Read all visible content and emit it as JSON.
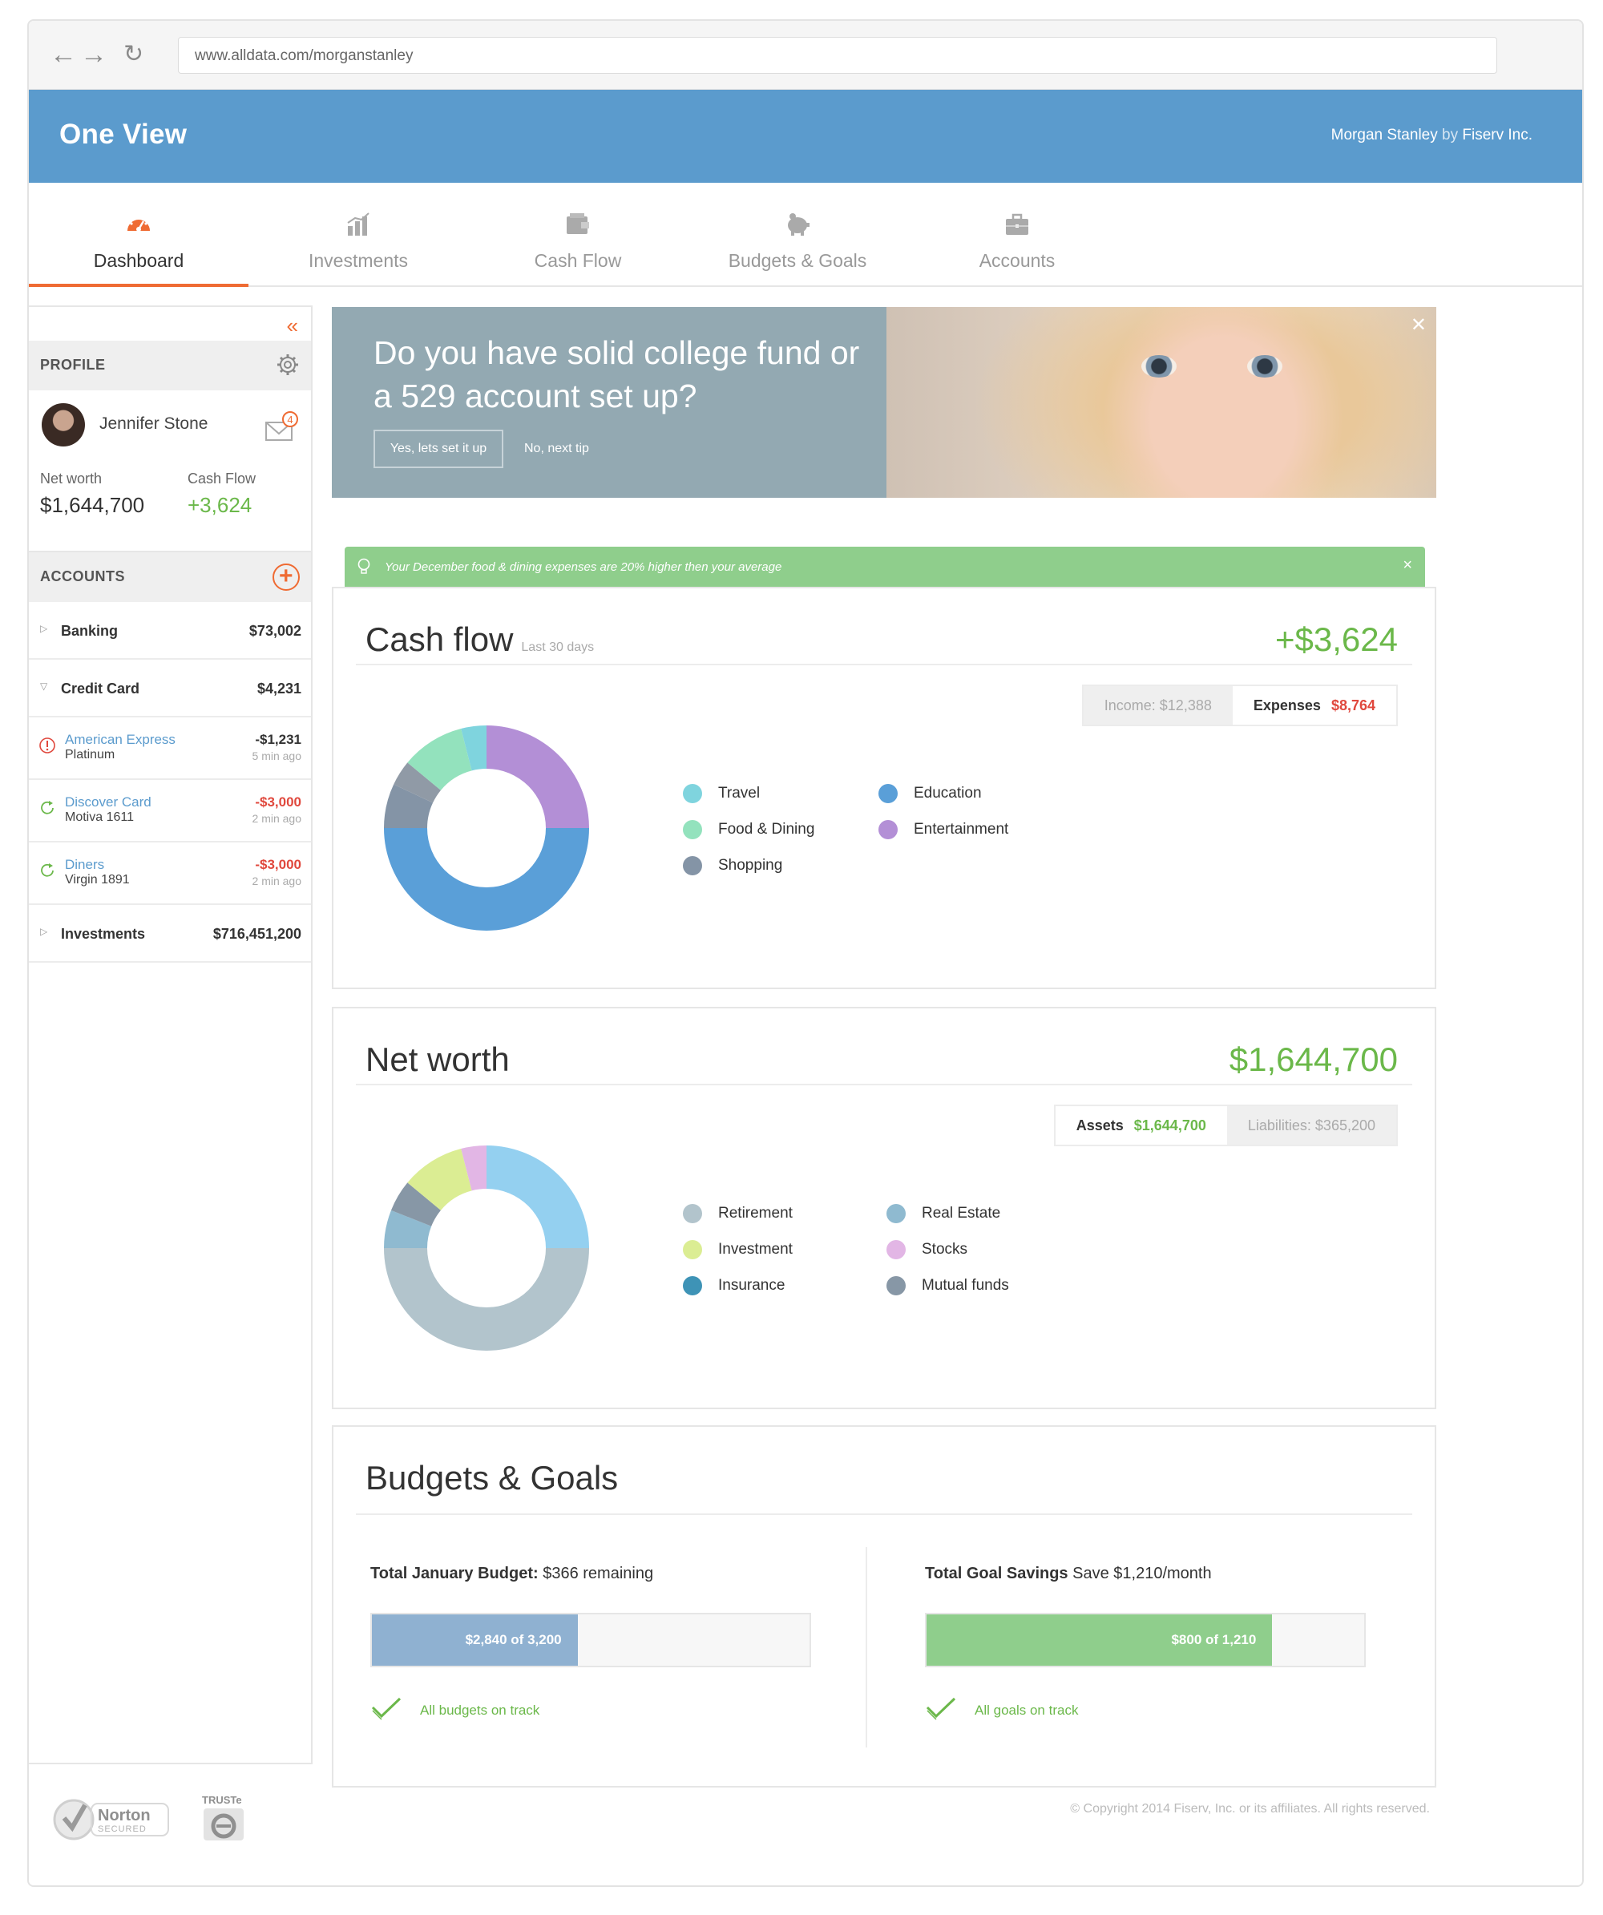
{
  "browser": {
    "url": "www.alldata.com/morganstanley"
  },
  "header": {
    "title": "One View",
    "brand_name": "Morgan Stanley",
    "brand_by": "by",
    "brand_company": "Fiserv Inc."
  },
  "tabs": [
    {
      "label": "Dashboard",
      "icon": "gauge-icon",
      "active": true
    },
    {
      "label": "Investments",
      "icon": "bar-chart-icon",
      "active": false
    },
    {
      "label": "Cash Flow",
      "icon": "wallet-icon",
      "active": false
    },
    {
      "label": "Budgets & Goals",
      "icon": "piggy-bank-icon",
      "active": false
    },
    {
      "label": "Accounts",
      "icon": "briefcase-icon",
      "active": false
    }
  ],
  "sidebar": {
    "profile_heading": "PROFILE",
    "user_name": "Jennifer Stone",
    "mail_count": "4",
    "net_worth_label": "Net worth",
    "net_worth_value": "$1,644,700",
    "cash_flow_label": "Cash Flow",
    "cash_flow_value": "+3,624",
    "accounts_heading": "ACCOUNTS",
    "accounts": [
      {
        "name": "Banking",
        "value": "$73,002"
      },
      {
        "name": "Credit Card",
        "value": "$4,231"
      },
      {
        "name": "Investments",
        "value": "$716,451,200"
      }
    ],
    "credit_cards": [
      {
        "name": "American Express",
        "sub": "Platinum",
        "amount": "-$1,231",
        "time": "5 min ago"
      },
      {
        "name": "Discover Card",
        "sub": "Motiva 1611",
        "amount": "-$3,000",
        "time": "2 min ago"
      },
      {
        "name": "Diners",
        "sub": "Virgin 1891",
        "amount": "-$3,000",
        "time": "2 min ago"
      }
    ]
  },
  "banner": {
    "text": "Do you have solid college fund or a 529 account set up?",
    "primary_button": "Yes, lets set it up",
    "secondary_link": "No, next tip"
  },
  "tip": {
    "text": "Your December food & dining expenses are 20% higher then your average"
  },
  "cash_flow": {
    "title": "Cash flow",
    "subtitle": "Last 30 days",
    "total": "+$3,624",
    "income_label": "Income:",
    "income_value": "$12,388",
    "expenses_label": "Expenses",
    "expenses_value": "$8,764",
    "legend": [
      "Travel",
      "Food & Dining",
      "Shopping",
      "Education",
      "Entertainment"
    ]
  },
  "net_worth": {
    "title": "Net worth",
    "total": "$1,644,700",
    "assets_label": "Assets",
    "assets_value": "$1,644,700",
    "liabilities_label": "Liabilities:",
    "liabilities_value": "$365,200",
    "legend": [
      "Retirement",
      "Investment",
      "Insurance",
      "Real Estate",
      "Stocks",
      "Mutual funds"
    ]
  },
  "budgets": {
    "title": "Budgets & Goals",
    "budget_label": "Total January Budget:",
    "budget_remaining": "$366 remaining",
    "budget_bar_text": "$2,840 of 3,200",
    "budget_fraction": 0.47,
    "budget_status": "All budgets on track",
    "goal_label": "Total Goal Savings",
    "goal_rate": "Save $1,210/month",
    "goal_bar_text": "$800 of 1,210",
    "goal_fraction": 0.79,
    "goal_status": "All goals on track"
  },
  "footer": {
    "norton_text": "Norton",
    "norton_sub": "SECURED",
    "truste_text": "TRUSTe",
    "copyright": "© Copyright 2014 Fiserv, Inc. or its affiliates. All rights reserved."
  },
  "colors": {
    "header_blue": "#5b9bcd",
    "accent_orange": "#ef6b33",
    "positive_green": "#6bb84a",
    "negative_red": "#e0483d",
    "tip_green": "#8fce8c",
    "travel": "#7fd4de",
    "food": "#93e2bd",
    "shopping": "#8494a6",
    "education": "#5a9fd8",
    "entertainment": "#b38fd6",
    "retirement": "#b2c4cc",
    "investment": "#dbed93",
    "insurance": "#3e93b6",
    "real_estate": "#8fbad0",
    "stocks": "#e2b6e5",
    "mutual_funds": "#8797a6",
    "net_blue": "#94d0f0"
  }
}
